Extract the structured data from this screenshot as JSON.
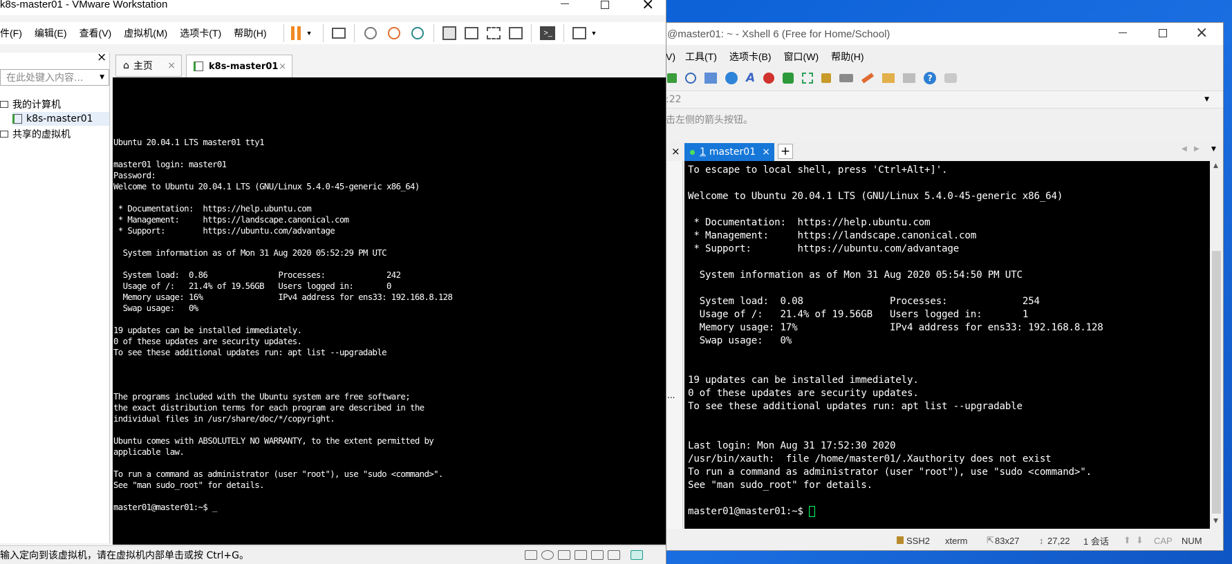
{
  "vmware": {
    "title": "k8s-master01 - VMware Workstation",
    "menu": [
      "件(F)",
      "编辑(E)",
      "查看(V)",
      "虚拟机(M)",
      "选项卡(T)",
      "帮助(H)"
    ],
    "search_placeholder": "在此处键入内容...",
    "tree": {
      "my_computer": "我的计算机",
      "vm": "k8s-master01",
      "shared": "共享的虚拟机"
    },
    "tabs": {
      "home": "主页",
      "vm": "k8s-master01"
    },
    "console_lines": [
      "",
      "",
      "Ubuntu 20.04.1 LTS master01 tty1",
      "",
      "master01 login: master01",
      "Password:",
      "Welcome to Ubuntu 20.04.1 LTS (GNU/Linux 5.4.0-45-generic x86_64)",
      "",
      " * Documentation:  https://help.ubuntu.com",
      " * Management:     https://landscape.canonical.com",
      " * Support:        https://ubuntu.com/advantage",
      "",
      "  System information as of Mon 31 Aug 2020 05:52:29 PM UTC",
      "",
      "  System load:  0.86               Processes:             242",
      "  Usage of /:   21.4% of 19.56GB   Users logged in:       0",
      "  Memory usage: 16%                IPv4 address for ens33: 192.168.8.128",
      "  Swap usage:   0%",
      "",
      "19 updates can be installed immediately.",
      "0 of these updates are security updates.",
      "To see these additional updates run: apt list --upgradable",
      "",
      "",
      "",
      "The programs included with the Ubuntu system are free software;",
      "the exact distribution terms for each program are described in the",
      "individual files in /usr/share/doc/*/copyright.",
      "",
      "Ubuntu comes with ABSOLUTELY NO WARRANTY, to the extent permitted by",
      "applicable law.",
      "",
      "To run a command as administrator (user \"root\"), use \"sudo <command>\".",
      "See \"man sudo_root\" for details.",
      "",
      "master01@master01:~$ _"
    ],
    "status": "输入定向到该虚拟机，请在虚拟机内部单击或按 Ctrl+G。"
  },
  "xshell": {
    "title": "@master01: ~ - Xshell 6 (Free for Home/School)",
    "menu": [
      "V)",
      "工具(T)",
      "选项卡(B)",
      "窗口(W)",
      "帮助(H)"
    ],
    "address": ":22",
    "hint": "击左侧的箭头按钮。",
    "tab_number": "1",
    "tab_label": "master01",
    "console_lines": [
      "To escape to local shell, press 'Ctrl+Alt+]'.",
      "",
      "Welcome to Ubuntu 20.04.1 LTS (GNU/Linux 5.4.0-45-generic x86_64)",
      "",
      " * Documentation:  https://help.ubuntu.com",
      " * Management:     https://landscape.canonical.com",
      " * Support:        https://ubuntu.com/advantage",
      "",
      "  System information as of Mon 31 Aug 2020 05:54:50 PM UTC",
      "",
      "  System load:  0.08               Processes:             254",
      "  Usage of /:   21.4% of 19.56GB   Users logged in:       1",
      "  Memory usage: 17%                IPv4 address for ens33: 192.168.8.128",
      "  Swap usage:   0%",
      "",
      "",
      "19 updates can be installed immediately.",
      "0 of these updates are security updates.",
      "To see these additional updates run: apt list --upgradable",
      "",
      "",
      "Last login: Mon Aug 31 17:52:30 2020",
      "/usr/bin/xauth:  file /home/master01/.Xauthority does not exist",
      "To run a command as administrator (user \"root\"), use \"sudo <command>\".",
      "See \"man sudo_root\" for details.",
      "",
      "master01@master01:~$ "
    ],
    "status": {
      "protocol": "SSH2",
      "term": "xterm",
      "size": "83x27",
      "cursor": "27,22",
      "sessions": "1 会话",
      "caps": "CAP",
      "num": "NUM"
    },
    "dots": "..."
  },
  "colors": {
    "accent": "#0078d7",
    "pause": "#f08a24",
    "cursor": "#00ff66"
  }
}
